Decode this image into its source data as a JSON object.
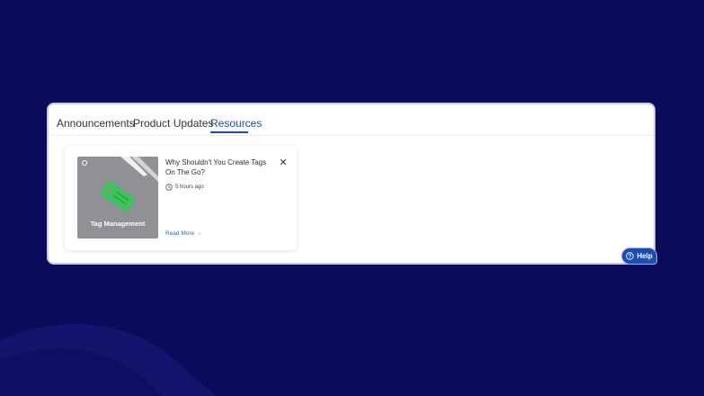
{
  "tabs": [
    {
      "label": "Announcements",
      "active": false
    },
    {
      "label": "Product Updates",
      "active": false
    },
    {
      "label": "Resources",
      "active": true
    }
  ],
  "card": {
    "title": "Why Shouldn't You Create Tags On The Go?",
    "time": "5 hours ago",
    "read_more": "Read More",
    "thumbnail_caption": "Tag Management",
    "close_icon": "close-icon"
  },
  "help": {
    "label": "Help",
    "icon": "question-icon"
  },
  "colors": {
    "background": "#0a0b5a",
    "accent": "#1b4db3",
    "link": "#2b63d6",
    "tag_green": "#3cc35a",
    "thumbnail": "#8f9195"
  }
}
